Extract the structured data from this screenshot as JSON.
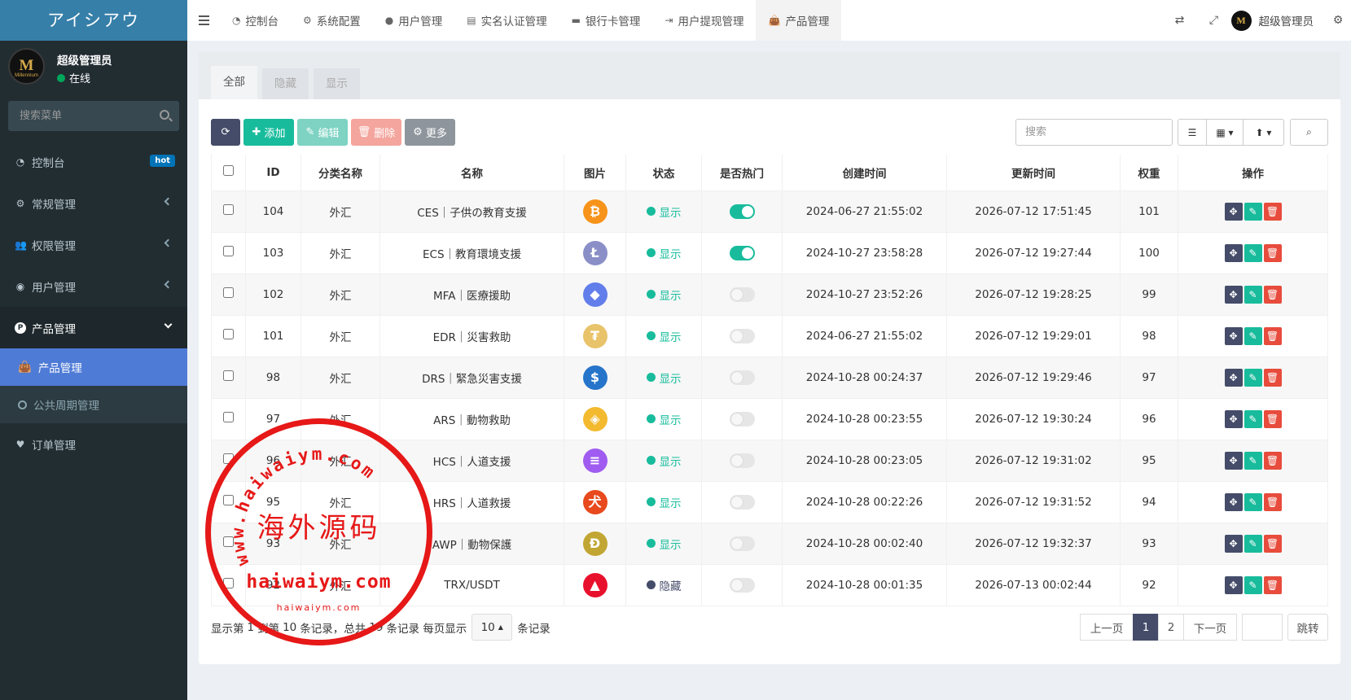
{
  "brand": "アイシアウ",
  "user": {
    "name": "超级管理员",
    "status": "在线",
    "avatar_mark": "M",
    "avatar_small": "Millennium"
  },
  "sidebar": {
    "search_placeholder": "搜索菜单",
    "items": [
      {
        "label": "控制台",
        "icon": "dashboard-icon",
        "badge": "hot"
      },
      {
        "label": "常规管理",
        "icon": "cogs-icon"
      },
      {
        "label": "权限管理",
        "icon": "group-icon"
      },
      {
        "label": "用户管理",
        "icon": "user-circle-icon"
      },
      {
        "label": "产品管理",
        "icon": "product-icon",
        "open": true
      },
      {
        "label": "订单管理",
        "icon": "heartbeat-icon"
      }
    ],
    "subitems": [
      {
        "label": "产品管理",
        "active": true
      },
      {
        "label": "公共周期管理"
      }
    ]
  },
  "nav": {
    "tabs": [
      "控制台",
      "系统配置",
      "用户管理",
      "实名认证管理",
      "银行卡管理",
      "用户提现管理",
      "产品管理"
    ],
    "admin": "超级管理员"
  },
  "page_tabs": [
    "全部",
    "隐藏",
    "显示"
  ],
  "toolbar": {
    "add": "添加",
    "edit": "编辑",
    "delete": "删除",
    "more": "更多",
    "search_placeholder": "搜索"
  },
  "table": {
    "headers": [
      "ID",
      "分类名称",
      "名称",
      "图片",
      "状态",
      "是否热门",
      "创建时间",
      "更新时间",
      "权重",
      "操作"
    ],
    "rows": [
      {
        "id": "104",
        "category": "外汇",
        "name": "CES｜子供の教育支援",
        "coin": {
          "sym": "₿",
          "color": "#f7931a"
        },
        "status": "显示",
        "hot": true,
        "created": "2024-06-27 21:55:02",
        "updated": "2026-07-12 17:51:45",
        "weight": "101"
      },
      {
        "id": "103",
        "category": "外汇",
        "name": "ECS｜教育環境支援",
        "coin": {
          "sym": "Ł",
          "color": "#8a8fc7"
        },
        "status": "显示",
        "hot": true,
        "created": "2024-10-27 23:58:28",
        "updated": "2026-07-12 19:27:44",
        "weight": "100"
      },
      {
        "id": "102",
        "category": "外汇",
        "name": "MFA｜医療援助",
        "coin": {
          "sym": "◆",
          "color": "#627eea"
        },
        "status": "显示",
        "hot": false,
        "created": "2024-10-27 23:52:26",
        "updated": "2026-07-12 19:28:25",
        "weight": "99"
      },
      {
        "id": "101",
        "category": "外汇",
        "name": "EDR｜災害救助",
        "coin": {
          "sym": "₮",
          "color": "#e8c36a"
        },
        "status": "显示",
        "hot": false,
        "created": "2024-06-27 21:55:02",
        "updated": "2026-07-12 19:29:01",
        "weight": "98"
      },
      {
        "id": "98",
        "category": "外汇",
        "name": "DRS｜緊急災害支援",
        "coin": {
          "sym": "$",
          "color": "#2775ca"
        },
        "status": "显示",
        "hot": false,
        "created": "2024-10-28 00:24:37",
        "updated": "2026-07-12 19:29:46",
        "weight": "97"
      },
      {
        "id": "97",
        "category": "外汇",
        "name": "ARS｜動物救助",
        "coin": {
          "sym": "◈",
          "color": "#f3ba2f"
        },
        "status": "显示",
        "hot": false,
        "created": "2024-10-28 00:23:55",
        "updated": "2026-07-12 19:30:24",
        "weight": "96"
      },
      {
        "id": "96",
        "category": "外汇",
        "name": "HCS｜人道支援",
        "coin": {
          "sym": "≡",
          "color": "#a05cf0"
        },
        "status": "显示",
        "hot": false,
        "created": "2024-10-28 00:23:05",
        "updated": "2026-07-12 19:31:02",
        "weight": "95"
      },
      {
        "id": "95",
        "category": "外汇",
        "name": "HRS｜人道救援",
        "coin": {
          "sym": "犬",
          "color": "#e8491d"
        },
        "status": "显示",
        "hot": false,
        "created": "2024-10-28 00:22:26",
        "updated": "2026-07-12 19:31:52",
        "weight": "94"
      },
      {
        "id": "93",
        "category": "外汇",
        "name": "AWP｜動物保護",
        "coin": {
          "sym": "Ð",
          "color": "#c2a633"
        },
        "status": "显示",
        "hot": false,
        "created": "2024-10-28 00:02:40",
        "updated": "2026-07-12 19:32:37",
        "weight": "93"
      },
      {
        "id": "92",
        "category": "外汇",
        "name": "TRX/USDT",
        "coin": {
          "sym": "▲",
          "color": "#e8112d"
        },
        "status": "隐藏",
        "hot": false,
        "created": "2024-10-28 00:01:35",
        "updated": "2026-07-13 00:02:44",
        "weight": "92"
      }
    ]
  },
  "footer": {
    "text1": "显示第",
    "from": "1",
    "text2": "到第",
    "to": "10",
    "text3": "条记录，总共",
    "total": "19",
    "text4": "条记录 每页显示",
    "page_size": "10",
    "text5": "条记录"
  },
  "pagination": {
    "prev": "上一页",
    "pages": [
      "1",
      "2"
    ],
    "next": "下一页",
    "jump": "跳转"
  },
  "stamp": {
    "title": "海外源码",
    "url_top": "www.haiwaiym.com",
    "url_bottom": "haiwaiym.com",
    "url_small": "haiwaiym.com"
  },
  "colors": {
    "sidebar": "#222d32",
    "active": "#4e7bd6",
    "primary": "#444c69",
    "success": "#18bc9c",
    "danger": "#e74c3c",
    "stamp": "#e61818"
  }
}
